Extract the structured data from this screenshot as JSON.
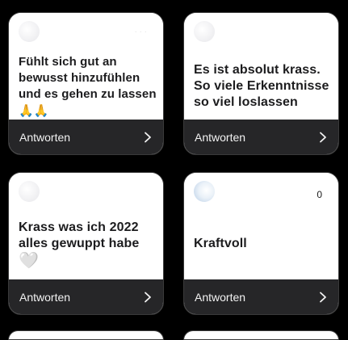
{
  "replies": [
    {
      "message": "Fühlt sich gut an bewusst hinzufühlen und es gehen zu lassen",
      "emoji": "🙏🙏",
      "corner_glyph": "",
      "reply_label": "Antworten"
    },
    {
      "message": "Es ist absolut krass. So viele Erkenntnisse so viel loslassen",
      "emoji": "",
      "corner_glyph": "",
      "reply_label": "Antworten"
    },
    {
      "message": "Krass was ich 2022 alles gewuppt habe",
      "emoji": "🤍",
      "corner_glyph": "",
      "reply_label": "Antworten"
    },
    {
      "message": "Kraftvoll",
      "emoji": "",
      "corner_glyph": "0",
      "reply_label": "Antworten"
    }
  ]
}
